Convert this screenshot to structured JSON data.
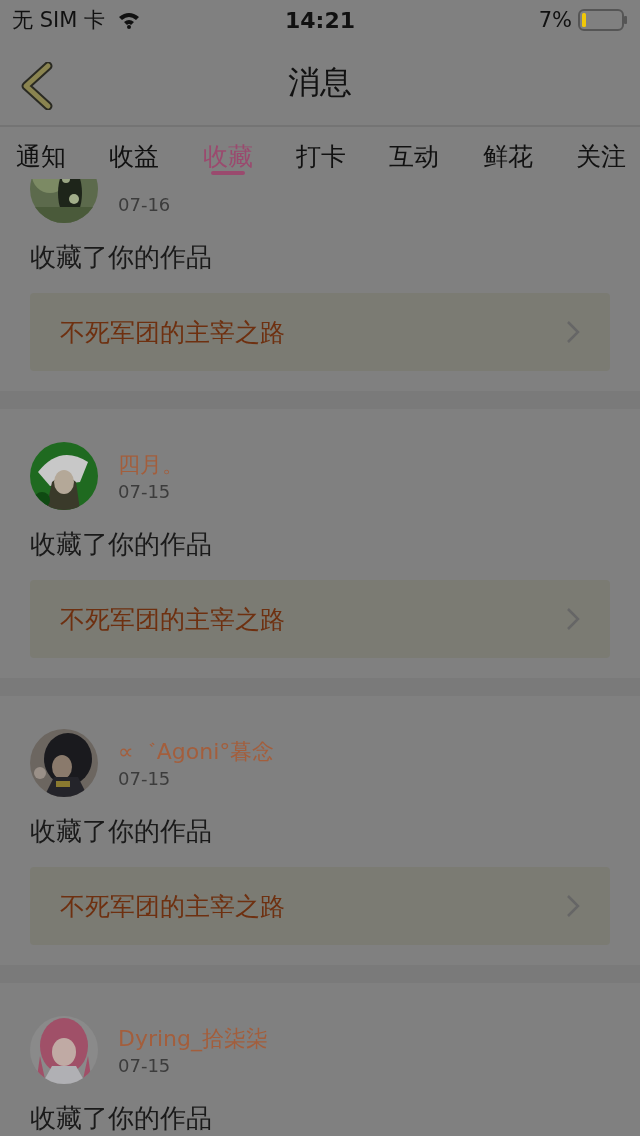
{
  "status_bar": {
    "carrier": "无 SIM 卡",
    "time": "14:21",
    "battery": "7%"
  },
  "nav": {
    "title": "消息"
  },
  "tabs": [
    {
      "label": "通知",
      "selected": false
    },
    {
      "label": "收益",
      "selected": false
    },
    {
      "label": "收藏",
      "selected": true
    },
    {
      "label": "打卡",
      "selected": false
    },
    {
      "label": "互动",
      "selected": false
    },
    {
      "label": "鲜花",
      "selected": false
    },
    {
      "label": "关注",
      "selected": false
    }
  ],
  "messages": [
    {
      "date": "07-16",
      "text": "收藏了你的作品",
      "work": "不死军团的主宰之路"
    },
    {
      "name": "四月。",
      "date": "07-15",
      "text": "收藏了你的作品",
      "work": "不死军团的主宰之路"
    },
    {
      "name": "∝゛Agoni°暮念",
      "date": "07-15",
      "text": "收藏了你的作品",
      "work": "不死军团的主宰之路"
    },
    {
      "name": "Dyring_拾柒柒",
      "date": "07-15",
      "text": "收藏了你的作品"
    }
  ]
}
